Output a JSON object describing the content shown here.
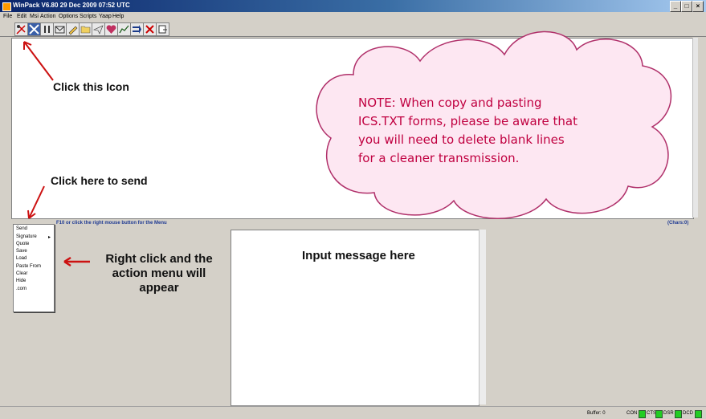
{
  "window": {
    "title": "WinPack V6.80   29 Dec 2009 07:52 UTC",
    "controls": [
      "_",
      "□",
      "×"
    ]
  },
  "menu": [
    "File",
    "Edit",
    "Msi",
    "Action",
    "Options",
    "Scripts",
    "Yaap",
    "Help"
  ],
  "toolbar": {
    "icons": [
      "connect-icon",
      "disconnect-icon",
      "pause-icon",
      "compose-icon",
      "edit-icon",
      "folder-icon",
      "send-icon",
      "heart-icon",
      "stats-icon",
      "forward-icon",
      "cancel-icon",
      "export-icon"
    ]
  },
  "status": {
    "help": "F10 or click the right mouse button for the Menu",
    "chars": "(Chars:0)",
    "buffer": "Buffer: 0",
    "leds": [
      "CON",
      "CTS",
      "DSR",
      "DCD"
    ]
  },
  "context_menu": [
    "Send",
    "Signature",
    "Quote",
    "Save",
    "Load",
    "Paste From",
    "Clear",
    "Hide",
    ".com"
  ],
  "annotations": {
    "click_icon": "Click this Icon",
    "click_send": "Click here to send",
    "right_click": [
      "Right click and the",
      "action menu will",
      "appear"
    ],
    "input_here": "Input message here",
    "note": [
      "NOTE: When copy and pasting",
      "ICS.TXT forms, please be aware that",
      "you will need to delete blank lines",
      "for a cleaner transmission."
    ]
  },
  "colors": {
    "titlebar": "#0a246a",
    "cloud_fill": "#fde7f2",
    "cloud_stroke": "#b0306a",
    "note_text": "#c00040",
    "arrow": "#cc1111",
    "led": "#22cc22"
  }
}
